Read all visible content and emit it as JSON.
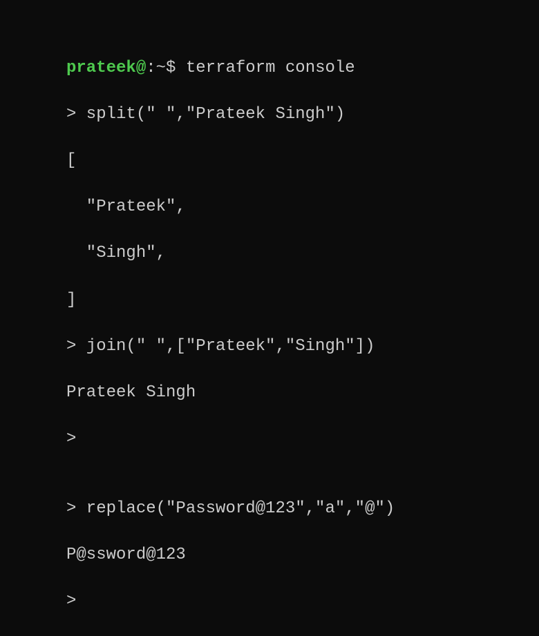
{
  "prompt": {
    "user": "prateek",
    "at": "@",
    "host_path": ":~",
    "dollar": "$ ",
    "command": "terraform console"
  },
  "lines": {
    "l1": "> split(\" \",\"Prateek Singh\")",
    "l2": "[",
    "l3": "  \"Prateek\",",
    "l4": "  \"Singh\",",
    "l5": "]",
    "l6": "> join(\" \",[\"Prateek\",\"Singh\"])",
    "l7": "Prateek Singh",
    "l8": ">",
    "l9": "",
    "l10": "> replace(\"Password@123\",\"a\",\"@\")",
    "l11": "P@ssword@123",
    "l12": ">"
  }
}
